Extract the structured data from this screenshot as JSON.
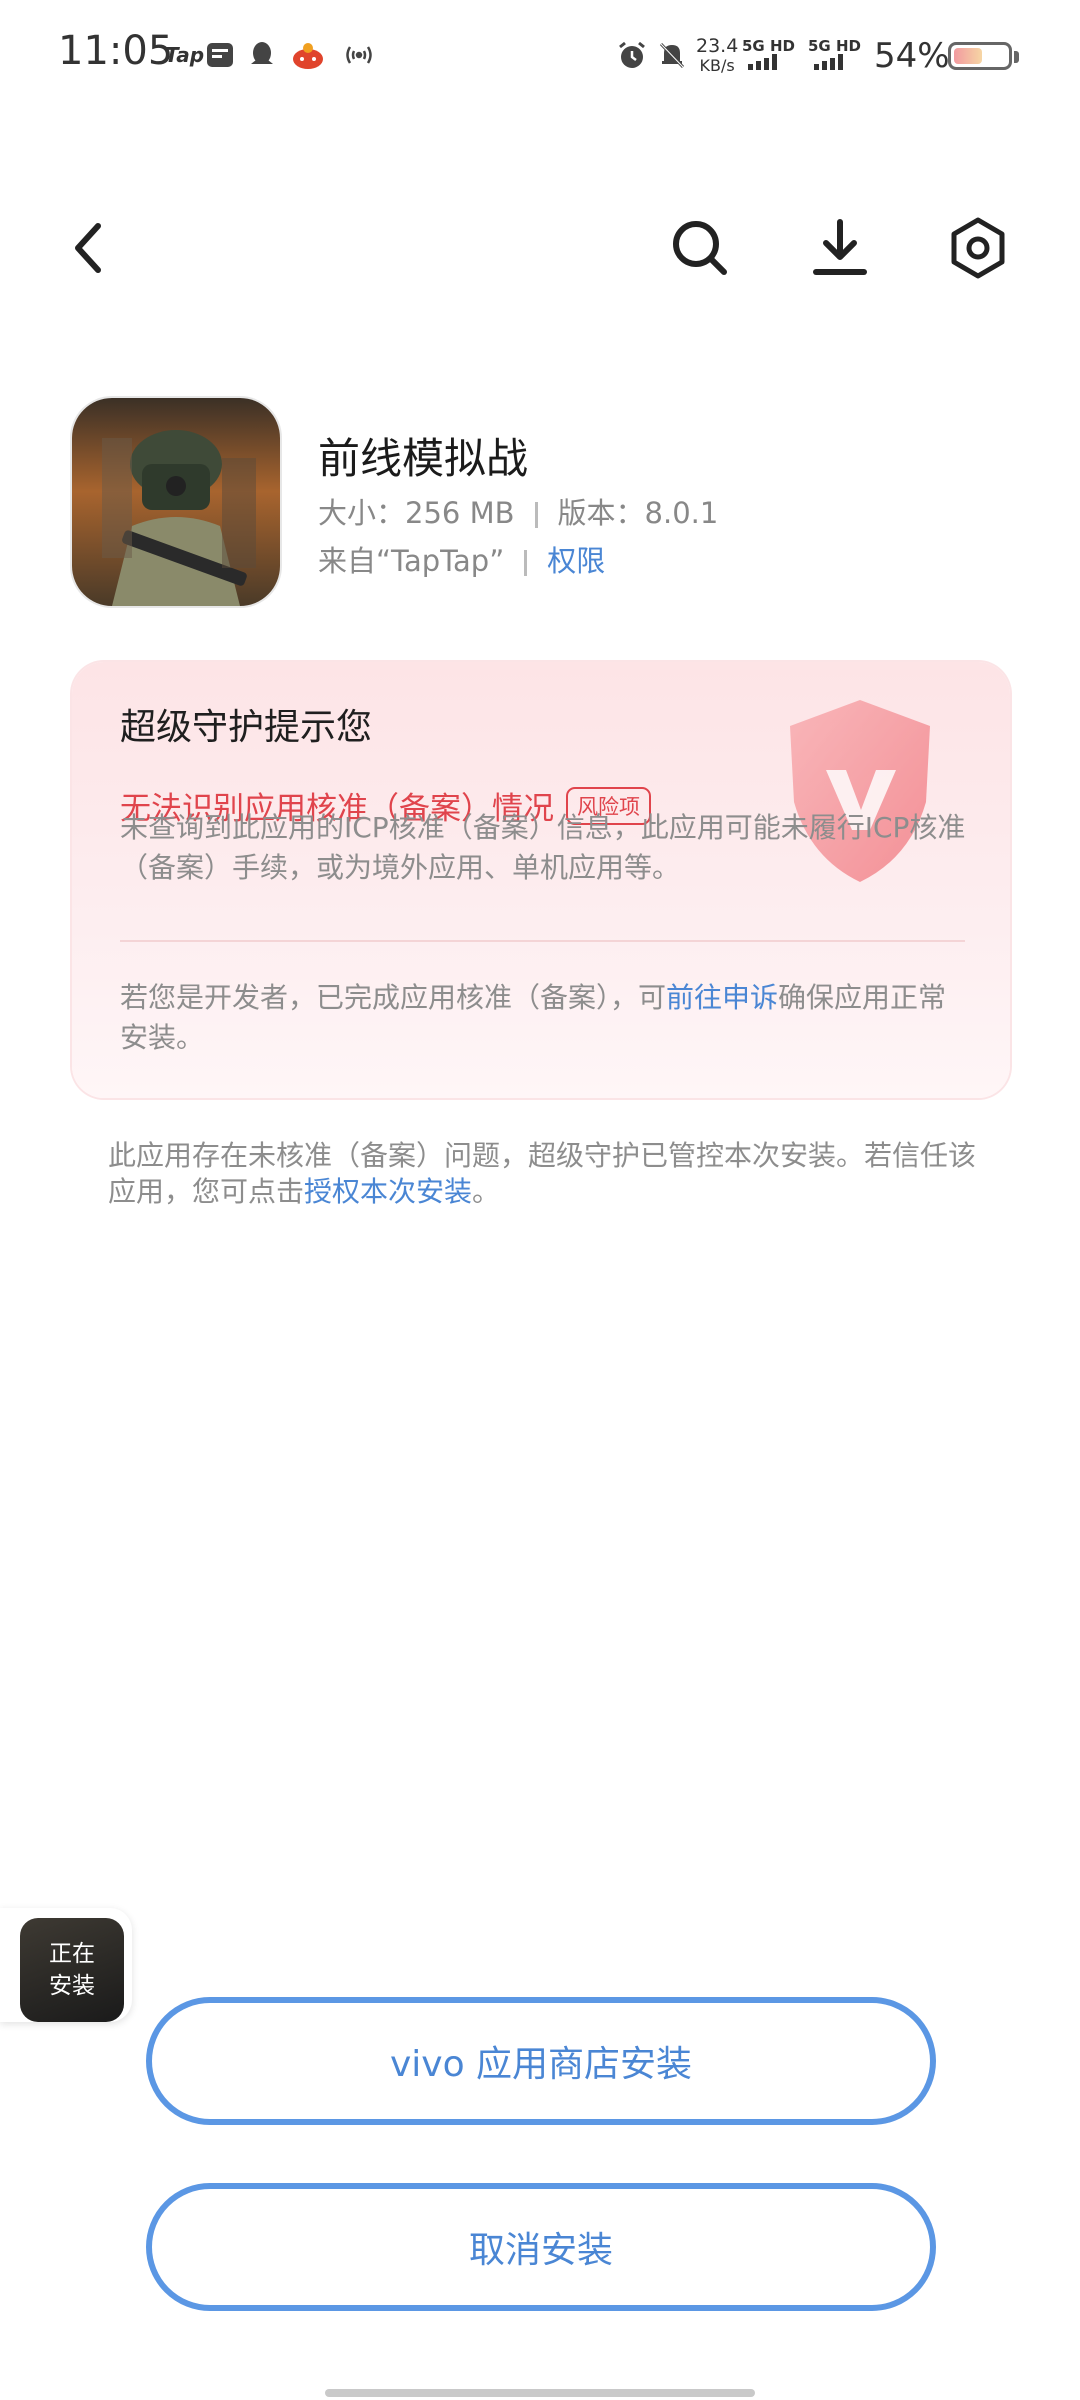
{
  "status_bar": {
    "time": "11:05",
    "tap_label": "Tap",
    "net_speed_value": "23.4",
    "net_speed_unit": "KB/s",
    "sim1": "5G HD",
    "sim2": "5G HD",
    "battery": "54%",
    "battery_level": 0.54
  },
  "app": {
    "name": "前线模拟战",
    "size_label": "大小：",
    "size_value": "256 MB",
    "version_label": "版本：",
    "version_value": "8.0.1",
    "source": "来自“TapTap”",
    "permissions_link": "权限"
  },
  "warning_card": {
    "title": "超级守护提示您",
    "risk_title": "无法识别应用核准（备案）情况",
    "risk_badge": "风险项",
    "risk_desc": "未查询到此应用的ICP核准（备案）信息，此应用可能未履行ICP核准（备案）手续，或为境外应用、单机应用等。",
    "dev_text_prefix": "若您是开发者，已完成应用核准（备案），可",
    "dev_link": "前往申诉",
    "dev_text_suffix": "确保应用正常安装。"
  },
  "notice": {
    "prefix": "此应用存在未核准（备案）问题，超级守护已管控本次安装。若信任该应用，您可点击",
    "link": "授权本次安装",
    "suffix": "。"
  },
  "floating": {
    "line1": "正在",
    "line2": "安装"
  },
  "buttons": {
    "install": "vivo 应用商店安装",
    "cancel": "取消安装"
  },
  "colors": {
    "accent": "#4a86d4",
    "danger": "#e0444c",
    "card_bg": "#fde4e6"
  }
}
